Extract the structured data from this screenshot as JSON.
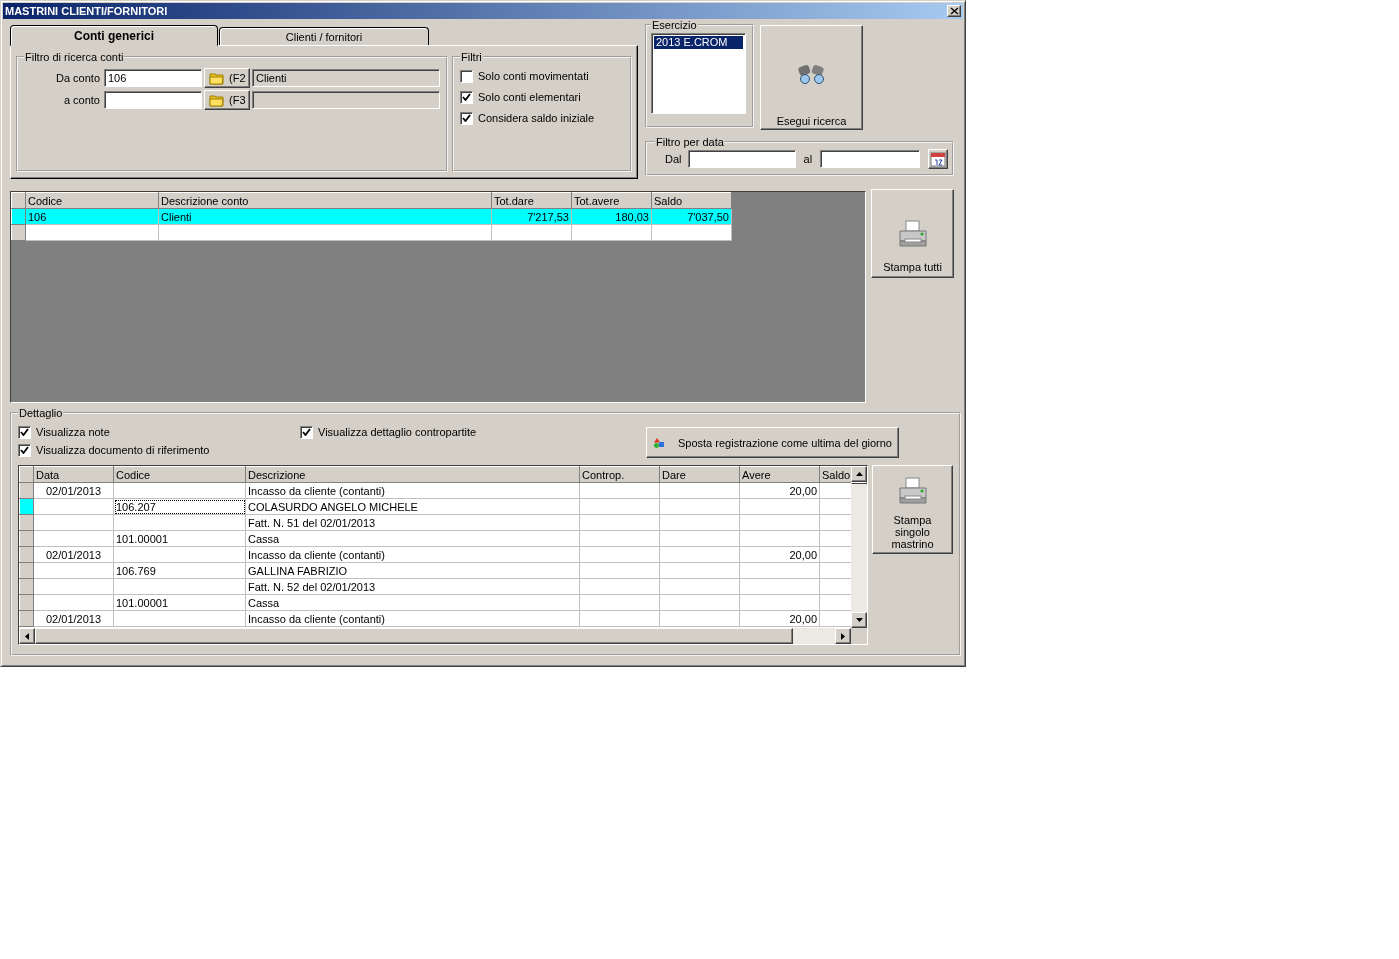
{
  "window": {
    "title": "MASTRINI CLIENTI/FORNITORI"
  },
  "tabs": [
    {
      "label": "Conti generici",
      "selected": true
    },
    {
      "label": "Clienti / fornitori",
      "selected": false
    }
  ],
  "account_filter": {
    "title": "Filtro di ricerca conti",
    "rows": [
      {
        "label": "Da conto",
        "value": "106",
        "key_hint": "(F2",
        "description": "Clienti"
      },
      {
        "label": "a conto",
        "key_hint": "(F3"
      }
    ]
  },
  "filters": {
    "title": "Filtri",
    "options": [
      {
        "label": "Solo conti movimentati",
        "checked": false
      },
      {
        "label": "Solo conti elementari",
        "checked": true
      },
      {
        "label": "Considera saldo iniziale",
        "checked": true
      }
    ]
  },
  "esercizio": {
    "title": "Esercizio",
    "items": [
      {
        "label": "2013 E.CROM",
        "selected": true
      }
    ]
  },
  "search_button": {
    "label": "Esegui ricerca"
  },
  "date_filter": {
    "title": "Filtro per data",
    "from_label": "Dal",
    "to_label": "al"
  },
  "accounts_table": {
    "columns": [
      "Codice",
      "Descrizione conto",
      "Tot.dare",
      "Tot.avere",
      "Saldo"
    ],
    "rows": [
      {
        "cells": [
          "106",
          "Clienti",
          "7'217,53",
          "180,03",
          "7'037,50"
        ],
        "selected": true
      }
    ]
  },
  "print_all_button": {
    "label": "Stampa tutti"
  },
  "detail": {
    "title": "Dettaglio",
    "options": [
      {
        "label": "Visualizza note",
        "checked": true
      },
      {
        "label": "Visualizza documento di riferimento",
        "checked": true
      },
      {
        "label": "Visualizza dettaglio contropartite",
        "checked": true
      }
    ],
    "move_button": {
      "label": "Sposta registrazione come ultima del giorno"
    },
    "table": {
      "columns": [
        "Data",
        "Codice",
        "Descrizione",
        "Controp.",
        "Dare",
        "Avere",
        "Saldo"
      ],
      "rows": [
        {
          "cells": [
            "02/01/2013",
            null,
            "Incasso da cliente (contanti)",
            null,
            null,
            "20,00",
            null
          ],
          "selected": false
        },
        {
          "cells": [
            null,
            "106.207",
            "COLASURDO ANGELO MICHELE",
            null,
            null,
            null,
            null
          ],
          "selected": true
        },
        {
          "cells": [
            null,
            null,
            "Fatt. N. 51 del 02/01/2013",
            null,
            null,
            null,
            null
          ],
          "selected": false
        },
        {
          "cells": [
            null,
            "101.00001",
            "Cassa",
            null,
            null,
            null,
            null
          ],
          "selected": false
        },
        {
          "cells": [
            "02/01/2013",
            null,
            "Incasso da cliente (contanti)",
            null,
            null,
            "20,00",
            null
          ],
          "selected": false
        },
        {
          "cells": [
            null,
            "106.769",
            "GALLINA FABRIZIO",
            null,
            null,
            null,
            null
          ],
          "selected": false
        },
        {
          "cells": [
            null,
            null,
            "Fatt. N. 52 del 02/01/2013",
            null,
            null,
            null,
            null
          ],
          "selected": false
        },
        {
          "cells": [
            null,
            "101.00001",
            "Cassa",
            null,
            null,
            null,
            null
          ],
          "selected": false
        },
        {
          "cells": [
            "02/01/2013",
            null,
            "Incasso da cliente (contanti)",
            null,
            null,
            "20,00",
            null
          ],
          "selected": false
        }
      ]
    },
    "print_button": {
      "label": "Stampa singolo mastrino"
    }
  }
}
